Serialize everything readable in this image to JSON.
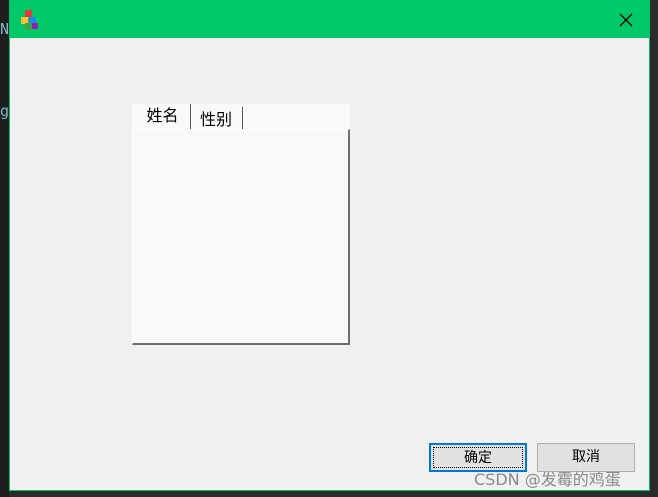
{
  "window": {
    "titlebar_color": "#00c96a",
    "icon": "app-cube-icon",
    "close_glyph": "✕"
  },
  "tabs": [
    {
      "label": "姓名",
      "selected": true
    },
    {
      "label": "性别",
      "selected": false
    }
  ],
  "buttons": {
    "ok_label": "确定",
    "cancel_label": "取消"
  },
  "watermark": "CSDN @发霉的鸡蛋",
  "background": {
    "char1": "N",
    "char2": "g"
  }
}
